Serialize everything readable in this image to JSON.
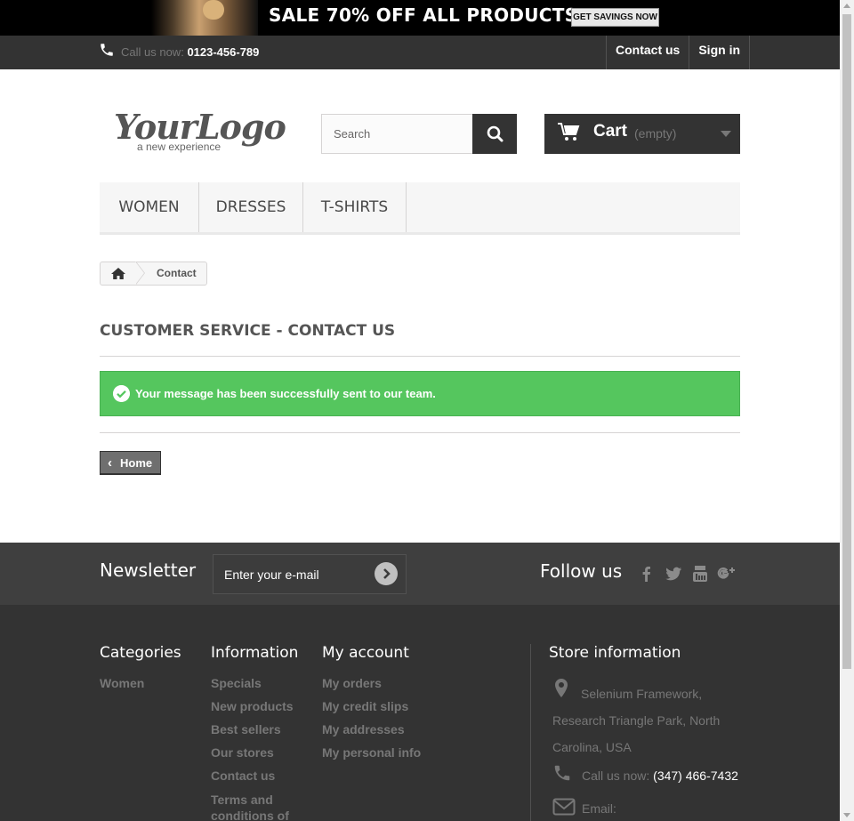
{
  "banner": {
    "sale_text": "SALE 70% OFF ALL PRODUCTS",
    "cta_label": "GET SAVINGS NOW"
  },
  "topnav": {
    "call_label": "Call us now:",
    "phone": "0123-456-789",
    "contact_label": "Contact us",
    "signin_label": "Sign in"
  },
  "header": {
    "logo_text": "YourLogo",
    "logo_tagline": "a new experience",
    "search_placeholder": "Search",
    "cart_label": "Cart",
    "cart_status": "(empty)"
  },
  "menu": {
    "items": [
      {
        "label": "WOMEN"
      },
      {
        "label": "DRESSES"
      },
      {
        "label": "T-SHIRTS"
      }
    ]
  },
  "breadcrumb": {
    "current": "Contact"
  },
  "main": {
    "heading": "CUSTOMER SERVICE - CONTACT US",
    "success_message": "Your message has been successfully sent to our team.",
    "home_button": "Home"
  },
  "newsletter": {
    "title": "Newsletter",
    "email_placeholder": "Enter your e-mail",
    "follow_title": "Follow us",
    "social_icons": [
      "facebook-icon",
      "twitter-icon",
      "youtube-icon",
      "google-plus-icon"
    ]
  },
  "footer": {
    "categories": {
      "title": "Categories",
      "links": [
        "Women"
      ]
    },
    "information": {
      "title": "Information",
      "links": [
        "Specials",
        "New products",
        "Best sellers",
        "Our stores",
        "Contact us",
        "Terms and conditions of"
      ]
    },
    "account": {
      "title": "My account",
      "links": [
        "My orders",
        "My credit slips",
        "My addresses",
        "My personal info"
      ]
    },
    "store": {
      "title": "Store information",
      "address_line1": "Selenium Framework,",
      "address_line2": "Research Triangle Park, North Carolina, USA",
      "call_label": "Call us now:",
      "phone": "(347) 466-7432",
      "email_label": "Email:"
    }
  },
  "colors": {
    "success": "#55c65e",
    "dark": "#333333",
    "footer_bar": "#3f3f3f"
  }
}
